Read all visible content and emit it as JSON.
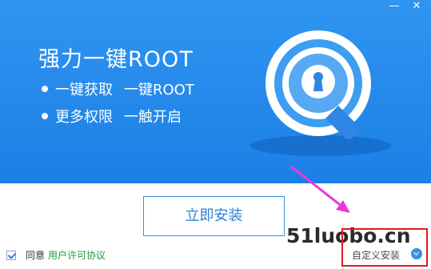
{
  "window": {
    "minimize_glyph": "—",
    "close_glyph": "✕"
  },
  "banner": {
    "headline": "强力一键ROOT",
    "features": [
      {
        "left": "一键获取",
        "right": "一键ROOT"
      },
      {
        "left": "更多权限",
        "right": "一触开启"
      }
    ],
    "logo_icon": "magnifier-keyhole-icon",
    "background_color": "#2488ec"
  },
  "install": {
    "label": "立即安装"
  },
  "agreement": {
    "checked": true,
    "agree_text": "同意",
    "license_link": "用户许可协议"
  },
  "custom_install": {
    "label": "自定义安装",
    "icon": "chevron-down-icon"
  },
  "watermark": {
    "text": "51luobo.cn"
  },
  "annotation": {
    "arrow_color": "#e83ad8",
    "box_color": "#e0191f"
  }
}
